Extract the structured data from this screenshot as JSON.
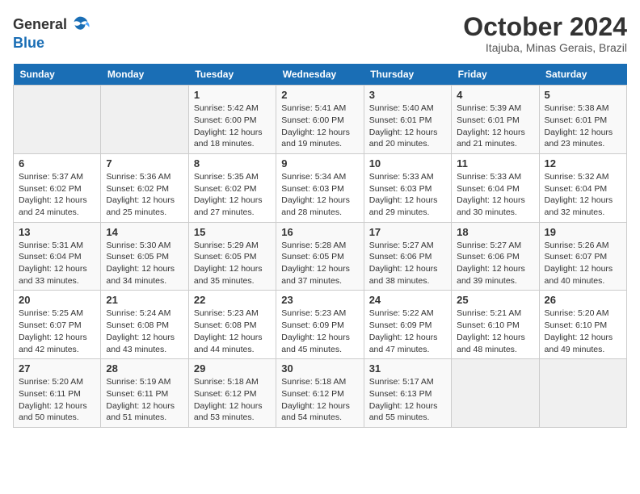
{
  "logo": {
    "general": "General",
    "blue": "Blue"
  },
  "title": "October 2024",
  "subtitle": "Itajuba, Minas Gerais, Brazil",
  "days_of_week": [
    "Sunday",
    "Monday",
    "Tuesday",
    "Wednesday",
    "Thursday",
    "Friday",
    "Saturday"
  ],
  "weeks": [
    [
      {
        "day": "",
        "info": ""
      },
      {
        "day": "",
        "info": ""
      },
      {
        "day": "1",
        "info": "Sunrise: 5:42 AM\nSunset: 6:00 PM\nDaylight: 12 hours and 18 minutes."
      },
      {
        "day": "2",
        "info": "Sunrise: 5:41 AM\nSunset: 6:00 PM\nDaylight: 12 hours and 19 minutes."
      },
      {
        "day": "3",
        "info": "Sunrise: 5:40 AM\nSunset: 6:01 PM\nDaylight: 12 hours and 20 minutes."
      },
      {
        "day": "4",
        "info": "Sunrise: 5:39 AM\nSunset: 6:01 PM\nDaylight: 12 hours and 21 minutes."
      },
      {
        "day": "5",
        "info": "Sunrise: 5:38 AM\nSunset: 6:01 PM\nDaylight: 12 hours and 23 minutes."
      }
    ],
    [
      {
        "day": "6",
        "info": "Sunrise: 5:37 AM\nSunset: 6:02 PM\nDaylight: 12 hours and 24 minutes."
      },
      {
        "day": "7",
        "info": "Sunrise: 5:36 AM\nSunset: 6:02 PM\nDaylight: 12 hours and 25 minutes."
      },
      {
        "day": "8",
        "info": "Sunrise: 5:35 AM\nSunset: 6:02 PM\nDaylight: 12 hours and 27 minutes."
      },
      {
        "day": "9",
        "info": "Sunrise: 5:34 AM\nSunset: 6:03 PM\nDaylight: 12 hours and 28 minutes."
      },
      {
        "day": "10",
        "info": "Sunrise: 5:33 AM\nSunset: 6:03 PM\nDaylight: 12 hours and 29 minutes."
      },
      {
        "day": "11",
        "info": "Sunrise: 5:33 AM\nSunset: 6:04 PM\nDaylight: 12 hours and 30 minutes."
      },
      {
        "day": "12",
        "info": "Sunrise: 5:32 AM\nSunset: 6:04 PM\nDaylight: 12 hours and 32 minutes."
      }
    ],
    [
      {
        "day": "13",
        "info": "Sunrise: 5:31 AM\nSunset: 6:04 PM\nDaylight: 12 hours and 33 minutes."
      },
      {
        "day": "14",
        "info": "Sunrise: 5:30 AM\nSunset: 6:05 PM\nDaylight: 12 hours and 34 minutes."
      },
      {
        "day": "15",
        "info": "Sunrise: 5:29 AM\nSunset: 6:05 PM\nDaylight: 12 hours and 35 minutes."
      },
      {
        "day": "16",
        "info": "Sunrise: 5:28 AM\nSunset: 6:05 PM\nDaylight: 12 hours and 37 minutes."
      },
      {
        "day": "17",
        "info": "Sunrise: 5:27 AM\nSunset: 6:06 PM\nDaylight: 12 hours and 38 minutes."
      },
      {
        "day": "18",
        "info": "Sunrise: 5:27 AM\nSunset: 6:06 PM\nDaylight: 12 hours and 39 minutes."
      },
      {
        "day": "19",
        "info": "Sunrise: 5:26 AM\nSunset: 6:07 PM\nDaylight: 12 hours and 40 minutes."
      }
    ],
    [
      {
        "day": "20",
        "info": "Sunrise: 5:25 AM\nSunset: 6:07 PM\nDaylight: 12 hours and 42 minutes."
      },
      {
        "day": "21",
        "info": "Sunrise: 5:24 AM\nSunset: 6:08 PM\nDaylight: 12 hours and 43 minutes."
      },
      {
        "day": "22",
        "info": "Sunrise: 5:23 AM\nSunset: 6:08 PM\nDaylight: 12 hours and 44 minutes."
      },
      {
        "day": "23",
        "info": "Sunrise: 5:23 AM\nSunset: 6:09 PM\nDaylight: 12 hours and 45 minutes."
      },
      {
        "day": "24",
        "info": "Sunrise: 5:22 AM\nSunset: 6:09 PM\nDaylight: 12 hours and 47 minutes."
      },
      {
        "day": "25",
        "info": "Sunrise: 5:21 AM\nSunset: 6:10 PM\nDaylight: 12 hours and 48 minutes."
      },
      {
        "day": "26",
        "info": "Sunrise: 5:20 AM\nSunset: 6:10 PM\nDaylight: 12 hours and 49 minutes."
      }
    ],
    [
      {
        "day": "27",
        "info": "Sunrise: 5:20 AM\nSunset: 6:11 PM\nDaylight: 12 hours and 50 minutes."
      },
      {
        "day": "28",
        "info": "Sunrise: 5:19 AM\nSunset: 6:11 PM\nDaylight: 12 hours and 51 minutes."
      },
      {
        "day": "29",
        "info": "Sunrise: 5:18 AM\nSunset: 6:12 PM\nDaylight: 12 hours and 53 minutes."
      },
      {
        "day": "30",
        "info": "Sunrise: 5:18 AM\nSunset: 6:12 PM\nDaylight: 12 hours and 54 minutes."
      },
      {
        "day": "31",
        "info": "Sunrise: 5:17 AM\nSunset: 6:13 PM\nDaylight: 12 hours and 55 minutes."
      },
      {
        "day": "",
        "info": ""
      },
      {
        "day": "",
        "info": ""
      }
    ]
  ]
}
